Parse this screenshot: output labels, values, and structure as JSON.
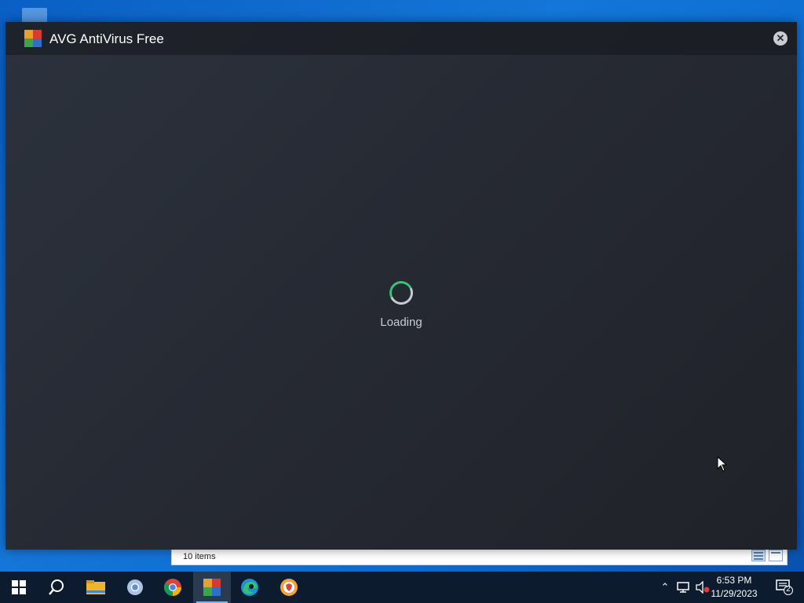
{
  "window": {
    "title": "AVG AntiVirus Free",
    "close_label": "✕",
    "loading_text": "Loading"
  },
  "explorer": {
    "status_text": "10 items"
  },
  "taskbar": {
    "apps": [
      {
        "name": "start",
        "icon": "windows-logo-icon"
      },
      {
        "name": "search",
        "icon": "search-icon"
      },
      {
        "name": "file-explorer",
        "icon": "folder-icon"
      },
      {
        "name": "chromium",
        "icon": "chromium-icon"
      },
      {
        "name": "chrome",
        "icon": "chrome-icon"
      },
      {
        "name": "avg",
        "icon": "avg-icon",
        "active": true
      },
      {
        "name": "edge",
        "icon": "edge-icon"
      },
      {
        "name": "avg-secure-browser",
        "icon": "secure-browser-icon"
      }
    ],
    "time": "6:53 PM",
    "date": "11/29/2023",
    "notification_count": "2"
  },
  "colors": {
    "spinner_accent": "#3ebf7a",
    "taskbar_bg": "#0c1b2e",
    "window_bg": "#262a33"
  }
}
